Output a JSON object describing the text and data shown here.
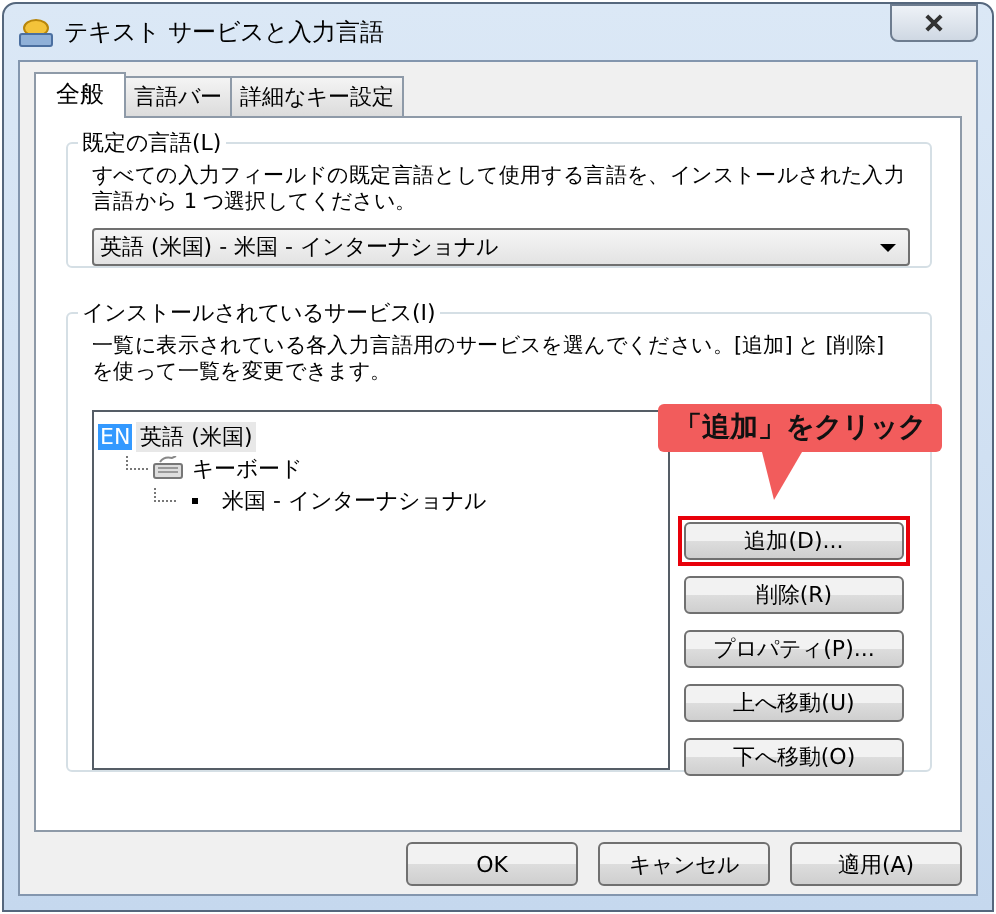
{
  "window": {
    "title": "テキスト サービスと入力言語"
  },
  "tabs": [
    {
      "label": "全般",
      "selected": true
    },
    {
      "label": "言語バー",
      "selected": false
    },
    {
      "label": "詳細なキー設定",
      "selected": false
    }
  ],
  "default_language": {
    "title": "既定の言語(L)",
    "description": "すべての入力フィールドの既定言語として使用する言語を、インストールされた入力言語から 1 つ選択してください。",
    "dropdown": {
      "value": "英語 (米国) - 米国 - インターナショナル"
    }
  },
  "installed_services": {
    "title": "インストールされているサービス(I)",
    "description": "一覧に表示されている各入力言語用のサービスを選んでください。[追加] と [削除] を使って一覧を変更できます。",
    "tree": [
      {
        "kind": "language",
        "badge": "EN",
        "label": "英語 (米国)",
        "selected": true,
        "children": [
          {
            "kind": "category",
            "label": "キーボード",
            "selected": false,
            "children": [
              {
                "kind": "service",
                "label": "米国 - インターナショナル",
                "selected": false
              }
            ]
          }
        ]
      }
    ],
    "buttons": [
      {
        "label": "追加(D)...",
        "highlighted": true
      },
      {
        "label": "削除(R)",
        "highlighted": false
      },
      {
        "label": "プロパティ(P)...",
        "highlighted": false
      },
      {
        "label": "上へ移動(U)",
        "highlighted": false
      },
      {
        "label": "下へ移動(O)",
        "highlighted": false
      }
    ]
  },
  "callout": {
    "text": "「追加」をクリック"
  },
  "footer_buttons": [
    {
      "label": "OK"
    },
    {
      "label": "キャンセル"
    },
    {
      "label": "適用(A)"
    }
  ]
}
